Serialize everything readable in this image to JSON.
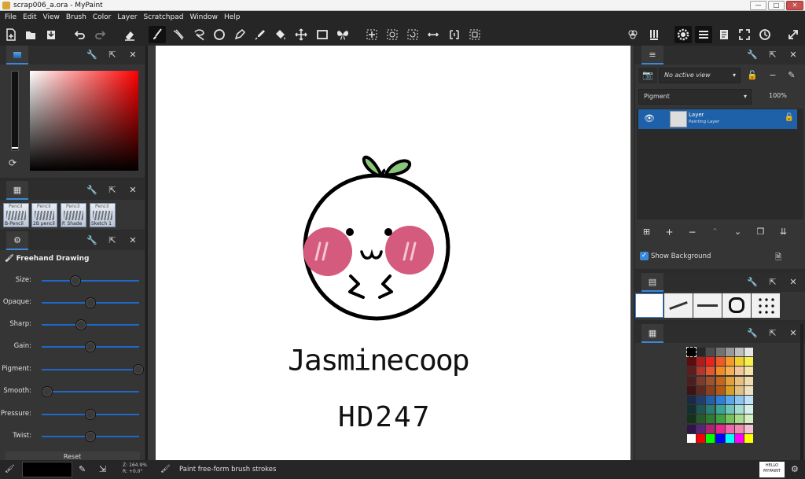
{
  "window": {
    "title": "scrap006_a.ora - MyPaint",
    "minimize": "—",
    "maximize": "□",
    "close": "✕"
  },
  "menu": [
    "File",
    "Edit",
    "View",
    "Brush",
    "Color",
    "Layer",
    "Scratchpad",
    "Window",
    "Help"
  ],
  "brush_presets": {
    "items": [
      {
        "top": "Pencil",
        "label": "B-Pencil"
      },
      {
        "top": "Pencil",
        "label": "2B pencil"
      },
      {
        "top": "Pencil",
        "label": "P. Shade"
      },
      {
        "top": "Pencil",
        "label": "Sketch 1"
      }
    ]
  },
  "brush_settings": {
    "mode": "Freehand Drawing",
    "sliders": [
      {
        "label": "Size:",
        "value": 0.31
      },
      {
        "label": "Opaque:",
        "value": 0.47
      },
      {
        "label": "Sharp:",
        "value": 0.37
      },
      {
        "label": "Gain:",
        "value": 0.47
      },
      {
        "label": "Pigment:",
        "value": 1.0
      },
      {
        "label": "Smooth:",
        "value": 0.0
      },
      {
        "label": "Pressure:",
        "value": 0.47
      },
      {
        "label": "Twist:",
        "value": 0.47
      }
    ],
    "reset_label": "Reset"
  },
  "canvas": {
    "text_line1": "Jasminecoop",
    "text_line2": "HD247"
  },
  "layers": {
    "view": "No active view",
    "mode": "Pigment",
    "opacity": "100%",
    "layer_name": "Layer",
    "layer_type": "Painting Layer",
    "show_background": "Show Background"
  },
  "palette": {
    "colors": [
      "#000000",
      "#262626",
      "#4d4d4d",
      "#737373",
      "#999999",
      "#bfbfbf",
      "#e6e6e6",
      "#5a0d0d",
      "#b01b1b",
      "#e8241f",
      "#f05a24",
      "#f59a2a",
      "#f4d02f",
      "#f7f04c",
      "#5e1d1d",
      "#b4372b",
      "#e7572b",
      "#f28b24",
      "#f5b054",
      "#f2c79c",
      "#f6e3a8",
      "#4b1f1f",
      "#7d3b2f",
      "#a0522d",
      "#c4661f",
      "#e2a03a",
      "#e7c07e",
      "#f0dcae",
      "#3c1414",
      "#5e2a1f",
      "#8b3f1d",
      "#b35a14",
      "#d69f25",
      "#e0c083",
      "#efe1c0",
      "#1a2a44",
      "#223e6b",
      "#2560a7",
      "#2f7fd6",
      "#5aa6e6",
      "#8cc6f0",
      "#c0e2f8",
      "#13302e",
      "#1f5552",
      "#2b7c74",
      "#3aa597",
      "#6ec4b7",
      "#a4ddd2",
      "#d6f1ec",
      "#16311a",
      "#255a2a",
      "#2e7b33",
      "#3fa140",
      "#76c35e",
      "#a9db8e",
      "#d6f0c3",
      "#2d1547",
      "#5b2577",
      "#b02272",
      "#e8288a",
      "#f266b0",
      "#ef8bb0",
      "#f5bfd3",
      "#ffffff",
      "#ff0000",
      "#00ff00",
      "#0000ff",
      "#00ffff",
      "#ff00ff",
      "#ffff00"
    ]
  },
  "status": {
    "zoom": "Z: 164.9%",
    "rotation": "R: +0.0°",
    "message": "Paint free-form brush strokes",
    "thumb_text": "HELLO MYPAINT"
  },
  "colors": {
    "accent": "#3a88d8",
    "selection": "#1f61a8",
    "cheek": "#d45b7d",
    "leaf": "#8ac67a"
  }
}
